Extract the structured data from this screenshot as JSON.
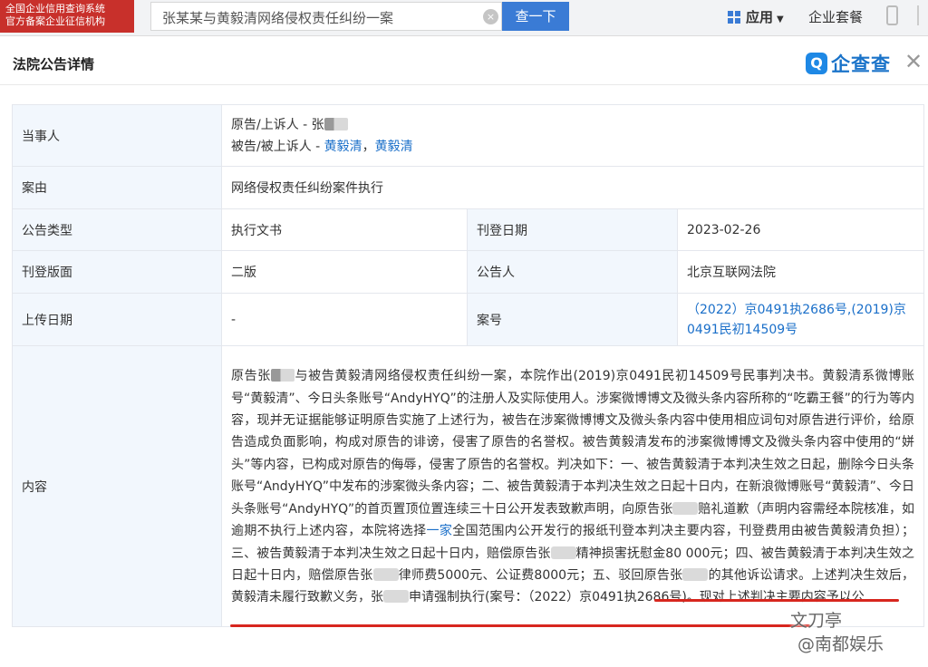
{
  "topbar": {
    "badge_line1": "全国企业信用查询系统",
    "badge_line2": "官方备案企业征信机构",
    "search_value": "张某某与黄毅清网络侵权责任纠纷一案",
    "clear_icon": "×",
    "search_button": "查一下",
    "apps_label": "应用",
    "apps_caret": "▼",
    "plan_label": "企业套餐"
  },
  "modal": {
    "title": "法院公告详情",
    "logo_mark": "Q",
    "logo_name": "企查查",
    "close_icon": "✕"
  },
  "table": {
    "party_label": "当事人",
    "plaintiff_prefix": "原告/上诉人 - 张",
    "defendant_prefix": "被告/被上诉人 - ",
    "defendant_link1": "黄毅清",
    "defendant_sep": "，",
    "defendant_link2": "黄毅清",
    "cause_label": "案由",
    "cause_value": "网络侵权责任纠纷案件执行",
    "type_label": "公告类型",
    "type_value": "执行文书",
    "pubdate_label": "刊登日期",
    "pubdate_value": "2023-02-26",
    "section_label": "刊登版面",
    "section_value": "二版",
    "announcer_label": "公告人",
    "announcer_value": "北京互联网法院",
    "upload_label": "上传日期",
    "upload_value": "-",
    "caseno_label": "案号",
    "caseno_value": "（2022）京0491执2686号,(2019)京0491民初14509号",
    "content_label": "内容",
    "content_p1": "原告张",
    "content_p2": "与被告黄毅清网络侵权责任纠纷一案，本院作出(2019)京0491民初14509号民事判决书。黄毅清系微博账号“黄毅清”、今日头条账号“AndyHYQ”的注册人及实际使用人。涉案微博博文及微头条内容所称的“吃霸王餐”的行为等内容，现并无证据能够证明原告实施了上述行为，被告在涉案微博博文及微头条内容中使用相应词句对原告进行评价，给原告造成负面影响，构成对原告的诽谤，侵害了原告的名誉权。被告黄毅清发布的涉案微博博文及微头条内容中使用的“姘头”等内容，已构成对原告的侮辱，侵害了原告的名誉权。判决如下：一、被告黄毅清于本判决生效之日起，删除今日头条账号“AndyHYQ”中发布的涉案微头条内容；二、被告黄毅清于本判决生效之日起十日内，在新浪微博账号“黄毅清”、今日头条账号“AndyHYQ”的首页置顶位置连续三十日公开发表致歉声明，向原告张",
    "content_p3": "赔礼道歉（声明内容需经本院核准，如逾期不执行上述内容，本院将选择",
    "content_link": "一家",
    "content_p4": "全国范围内公开发行的报纸刊登本判决主要内容，刊登费用由被告黄毅清负担）；三、被告黄毅清于本判决生效之日起十日内，赔偿原告张",
    "content_p5": "精神损害抚慰金80 000元；四、被告黄毅清于本判决生效之日起十日内，赔偿原告张",
    "content_p6": "律师费5000元、公证费8000元；五、驳回原告张",
    "content_p7": "的其他诉讼请求。上述判决生效后，黄毅清未履行致歉义务，张",
    "content_p8": "申请强制执行(案号：（2022）京0491执2686号)。现对上述判决主要内容予以公"
  },
  "watermark": {
    "line1": "文刀亭",
    "line2": "@南都娱乐"
  },
  "colors": {
    "accent": "#3a7bd5",
    "link": "#1a6fc9",
    "badge": "#c8302b",
    "label_bg": "#f2f7fd",
    "underline": "#d7261e"
  }
}
